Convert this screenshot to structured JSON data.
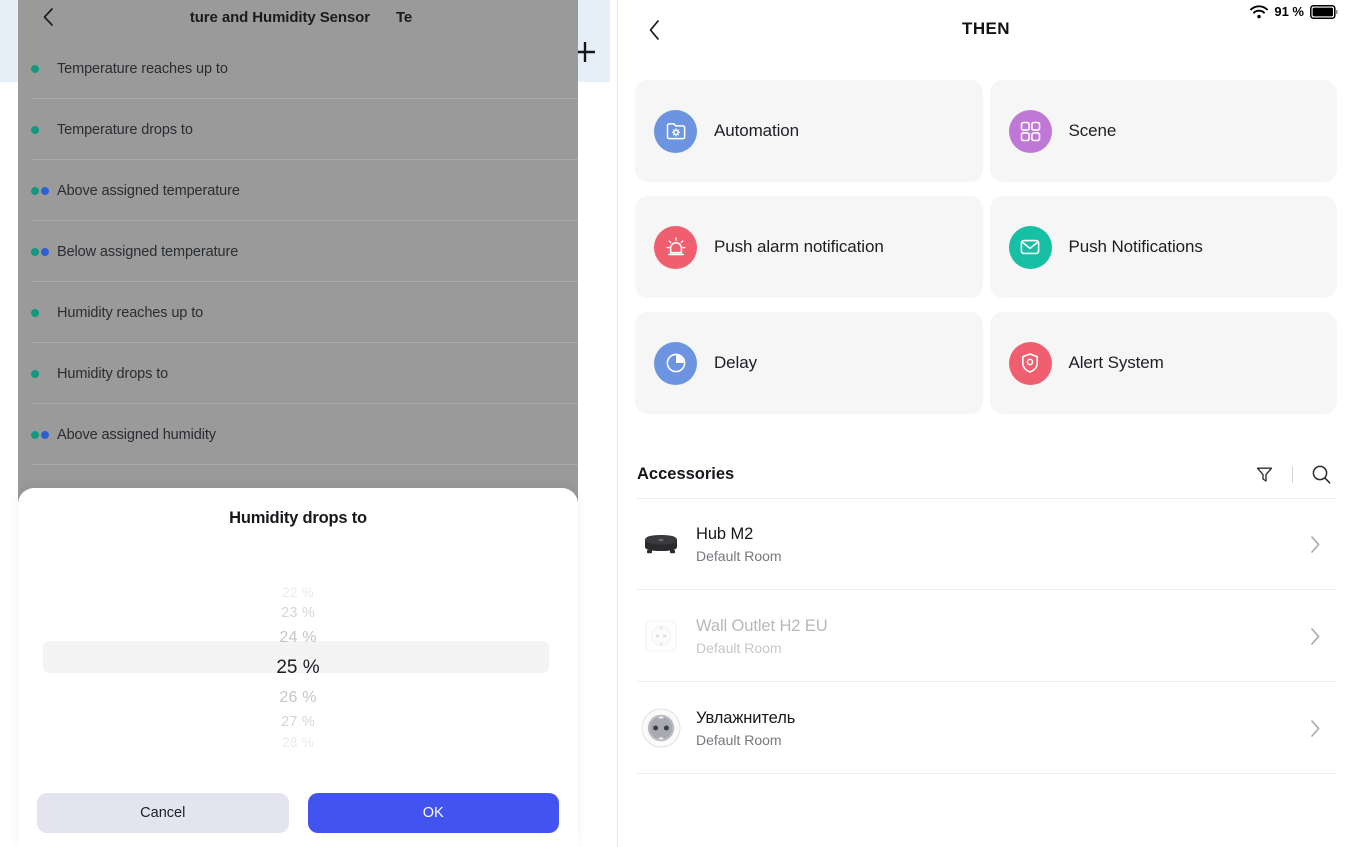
{
  "left_panel": {
    "add_button": "+",
    "back_icon": "chevron-left-icon",
    "header_title_fragment_1": "ture and Humidity Sensor",
    "header_title_fragment_2": "Te",
    "triggers": [
      {
        "label": "Temperature reaches up to",
        "markers": [
          "teal"
        ]
      },
      {
        "label": "Temperature drops to",
        "markers": [
          "teal"
        ]
      },
      {
        "label": "Above assigned temperature",
        "markers": [
          "teal",
          "blue"
        ]
      },
      {
        "label": "Below assigned temperature",
        "markers": [
          "teal",
          "blue"
        ]
      },
      {
        "label": "Humidity reaches up to",
        "markers": [
          "teal"
        ]
      },
      {
        "label": "Humidity drops to",
        "markers": [
          "teal"
        ]
      },
      {
        "label": "Above assigned humidity",
        "markers": [
          "teal",
          "blue"
        ]
      }
    ]
  },
  "picker": {
    "title": "Humidity drops to",
    "values": [
      "22 %",
      "23 %",
      "24 %",
      "25 %",
      "26 %",
      "27 %",
      "28 %"
    ],
    "selected_value": "25 %",
    "selected_index": 3,
    "cancel_label": "Cancel",
    "ok_label": "OK",
    "ok_color": "#4353f0",
    "cancel_color": "#e3e4ef"
  },
  "right_panel": {
    "status_bar": {
      "wifi_icon": "wifi-icon",
      "battery_percent": "91 %",
      "battery_icon": "battery-full-icon"
    },
    "back_icon": "chevron-left-icon",
    "title": "THEN",
    "actions": [
      {
        "label": "Automation",
        "icon": "automation-folder-gear-icon",
        "color": "#6d94e0"
      },
      {
        "label": "Scene",
        "icon": "scene-grid-icon",
        "color": "#c078d6"
      },
      {
        "label": "Push alarm notification",
        "icon": "alarm-siren-icon",
        "color": "#ef5f70"
      },
      {
        "label": "Push Notifications",
        "icon": "envelope-icon",
        "color": "#17bfa5"
      },
      {
        "label": "Delay",
        "icon": "clock-pie-icon",
        "color": "#6d94e0"
      },
      {
        "label": "Alert System",
        "icon": "shield-alert-icon",
        "color": "#ef5f70"
      }
    ],
    "accessories": {
      "title": "Accessories",
      "filter_icon": "filter-funnel-icon",
      "search_icon": "search-icon",
      "items": [
        {
          "name": "Hub M2",
          "room": "Default Room",
          "thumb": "hub-device-icon",
          "disabled": false
        },
        {
          "name": "Wall Outlet H2 EU",
          "room": "Default Room",
          "thumb": "wall-outlet-icon",
          "disabled": true
        },
        {
          "name": "Увлажнитель",
          "room": "Default Room",
          "thumb": "socket-plug-icon",
          "disabled": false
        }
      ],
      "chevron_icon": "chevron-right-icon"
    }
  }
}
